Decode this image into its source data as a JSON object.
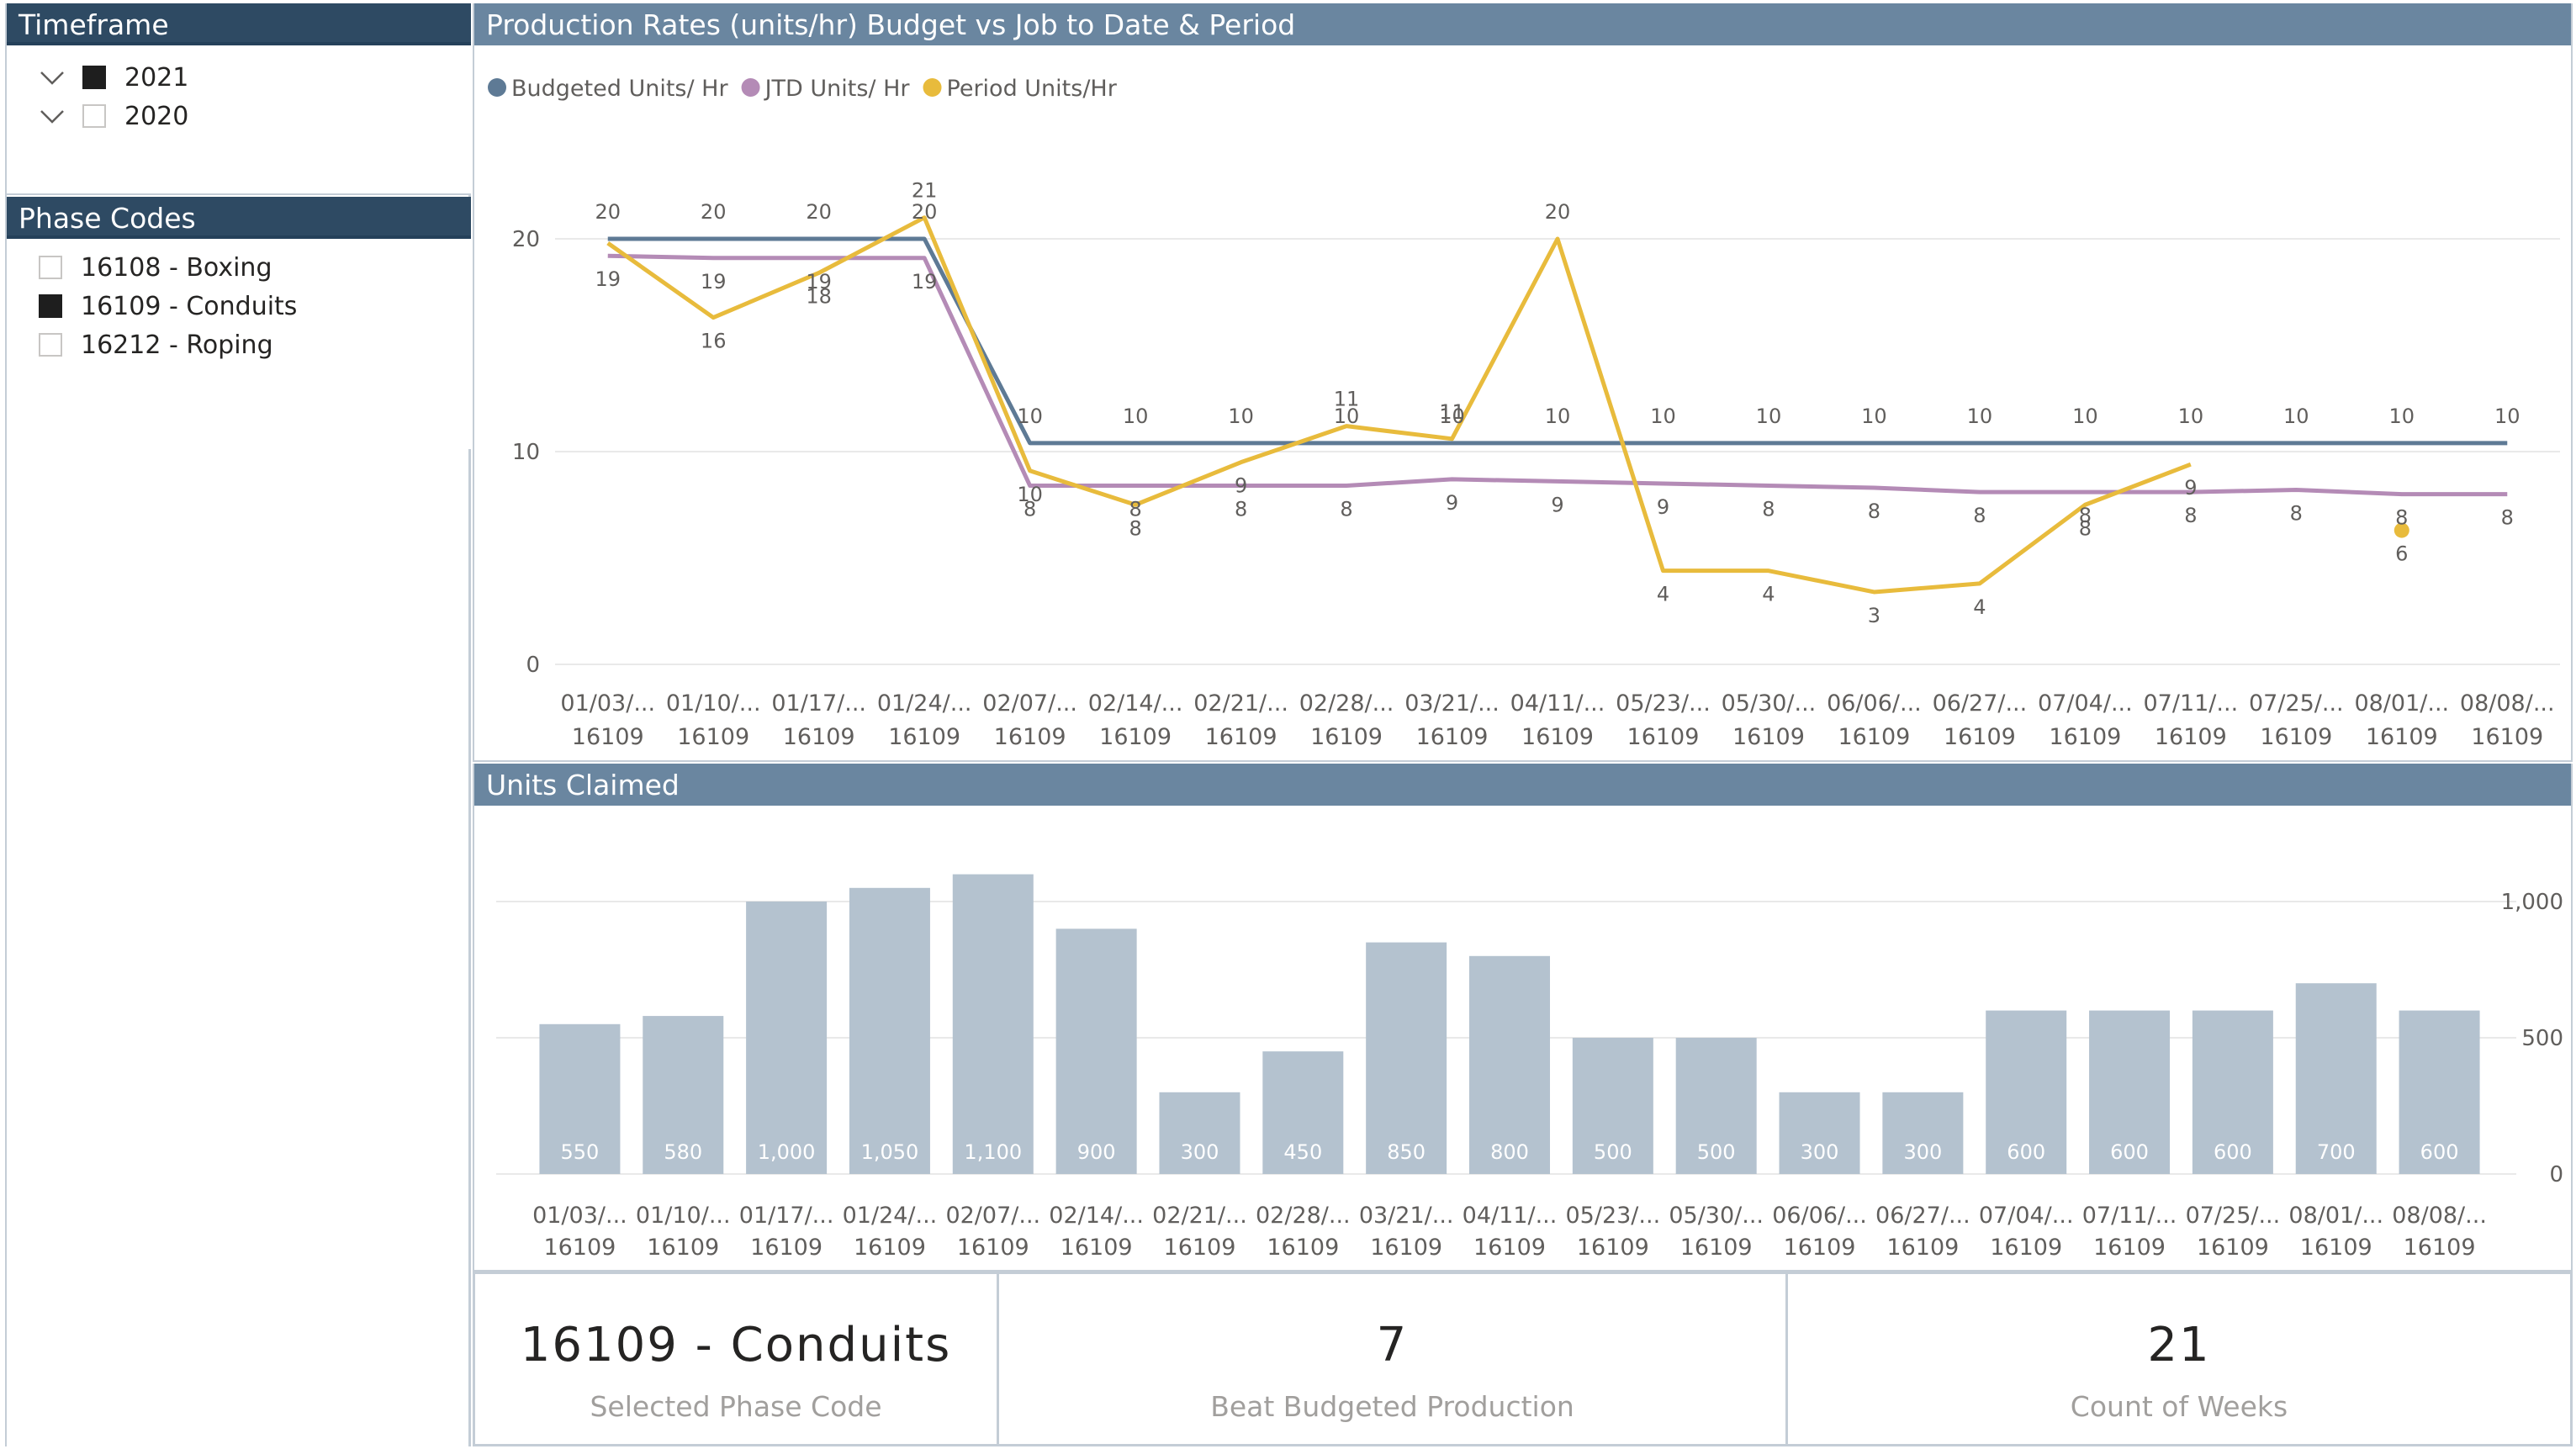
{
  "timeframe": {
    "title": "Timeframe",
    "items": [
      {
        "label": "2021",
        "checked": true
      },
      {
        "label": "2020",
        "checked": false
      }
    ]
  },
  "phase_codes": {
    "title": "Phase Codes",
    "items": [
      {
        "label": "16108 - Boxing",
        "checked": false
      },
      {
        "label": "16109 - Conduits",
        "checked": true
      },
      {
        "label": "16212 - Roping",
        "checked": false
      }
    ]
  },
  "colors": {
    "budget": "#5e7a95",
    "jtd": "#b48bb6",
    "period": "#e8bb3c",
    "bar": "#b4c2cf",
    "header_dark": "#2e4a63",
    "header_steel": "#6a86a0"
  },
  "production_chart": {
    "title": "Production Rates (units/hr) Budget vs Job to Date & Period",
    "legend": [
      "Budgeted Units/ Hr",
      "JTD Units/ Hr",
      "Period Units/Hr"
    ]
  },
  "units_chart": {
    "title": "Units Claimed"
  },
  "kpis": [
    {
      "value": "16109 - Conduits",
      "label": "Selected Phase Code"
    },
    {
      "value": "7",
      "label": "Beat Budgeted Production"
    },
    {
      "value": "21",
      "label": "Count of Weeks"
    }
  ],
  "chart_data": [
    {
      "type": "line",
      "title": "Production Rates (units/hr) Budget vs Job to Date & Period",
      "categories": [
        "01/03/...",
        "01/10/...",
        "01/17/...",
        "01/24/...",
        "02/07/...",
        "02/14/...",
        "02/21/...",
        "02/28/...",
        "03/21/...",
        "04/11/...",
        "05/23/...",
        "05/30/...",
        "06/06/...",
        "06/27/...",
        "07/04/...",
        "07/11/...",
        "07/25/...",
        "08/01/...",
        "08/08/..."
      ],
      "category_sublabel": "16109",
      "ylim": [
        0,
        20
      ],
      "yticks": [
        0,
        10,
        20
      ],
      "grid": true,
      "legend_position": "top-left",
      "series": [
        {
          "name": "Budgeted Units/ Hr",
          "values": [
            20,
            20,
            20,
            20,
            10.4,
            10.4,
            10.4,
            10.4,
            10.4,
            10.4,
            10.4,
            10.4,
            10.4,
            10.4,
            10.4,
            10.4,
            10.4,
            10.4,
            10.4
          ],
          "labels": [
            "20",
            "20",
            "20",
            "20",
            "10",
            "10",
            "10",
            "10",
            "10",
            "10",
            "10",
            "10",
            "10",
            "10",
            "10",
            "10",
            "10",
            "10",
            "10"
          ]
        },
        {
          "name": "JTD Units/ Hr",
          "values": [
            19.2,
            19.1,
            19.1,
            19.1,
            8.4,
            8.4,
            8.4,
            8.4,
            8.7,
            8.6,
            8.5,
            8.4,
            8.3,
            8.1,
            8.1,
            8.1,
            8.2,
            8.0,
            8.0
          ],
          "labels": [
            "19",
            "19",
            "19",
            "19",
            "8",
            "8",
            "8",
            "8",
            "9",
            "9",
            "9",
            "8",
            "8",
            "8",
            "8",
            "8",
            "8",
            "8",
            "8"
          ]
        },
        {
          "name": "Period Units/Hr",
          "values": [
            19.8,
            16.3,
            18.4,
            21,
            9.1,
            7.5,
            9.5,
            11.2,
            10.6,
            20,
            4.4,
            4.4,
            3.4,
            3.8,
            7.5,
            9.4,
            null,
            6.3,
            null
          ],
          "labels": [
            "",
            "16",
            "18",
            "21",
            "10",
            "8",
            "9",
            "11",
            "11",
            "20",
            "4",
            "4",
            "3",
            "4",
            "8",
            "9",
            "",
            "6",
            ""
          ]
        }
      ]
    },
    {
      "type": "bar",
      "title": "Units Claimed",
      "categories": [
        "01/03/...",
        "01/10/...",
        "01/17/...",
        "01/24/...",
        "02/07/...",
        "02/14/...",
        "02/21/...",
        "02/28/...",
        "03/21/...",
        "04/11/...",
        "05/23/...",
        "05/30/...",
        "06/06/...",
        "06/27/...",
        "07/04/...",
        "07/11/...",
        "07/25/...",
        "08/01/...",
        "08/08/..."
      ],
      "category_sublabel": "16109",
      "values": [
        550,
        580,
        1000,
        1050,
        1100,
        900,
        300,
        450,
        850,
        800,
        500,
        500,
        300,
        300,
        600,
        600,
        600,
        700,
        600
      ],
      "value_labels": [
        "550",
        "580",
        "1,000",
        "1,050",
        "1,100",
        "900",
        "300",
        "450",
        "850",
        "800",
        "500",
        "500",
        "300",
        "300",
        "600",
        "600",
        "600",
        "700",
        "600"
      ],
      "ylim": [
        0,
        1000
      ],
      "yticks": [
        {
          "v": 0,
          "t": "0"
        },
        {
          "v": 500,
          "t": "500"
        },
        {
          "v": 1000,
          "t": "1,000"
        }
      ],
      "grid": true
    }
  ]
}
